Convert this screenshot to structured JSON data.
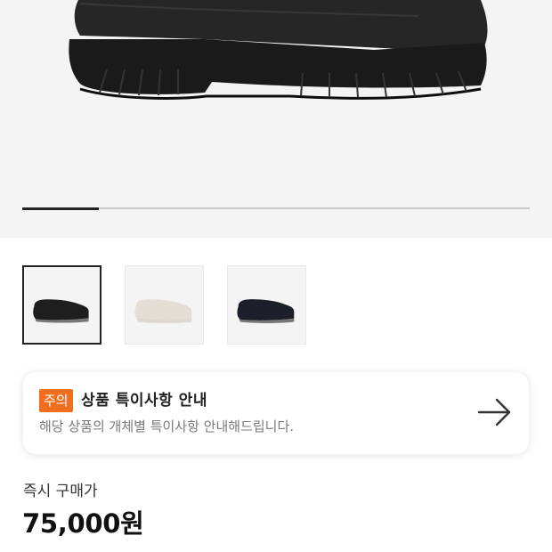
{
  "product": {
    "image_alt": "shoe-black",
    "carousel_progress": 0.15
  },
  "thumbnails": [
    {
      "name": "black",
      "color": "#1e1e1e",
      "selected": true
    },
    {
      "name": "ivory",
      "color": "#e3ded3",
      "selected": false
    },
    {
      "name": "navy",
      "color": "#1c1f2a",
      "selected": false
    }
  ],
  "notice": {
    "badge": "주의",
    "title": "상품 특이사항 안내",
    "subtitle": "해당 상품의 개체별 특이사항 안내해드립니다.",
    "arrow_icon": "arrow-right-icon"
  },
  "price": {
    "label": "즉시 구매가",
    "value": "75,000원"
  },
  "colors": {
    "badge": "#ef6f1f",
    "hero_bg": "#f4f4f4"
  }
}
